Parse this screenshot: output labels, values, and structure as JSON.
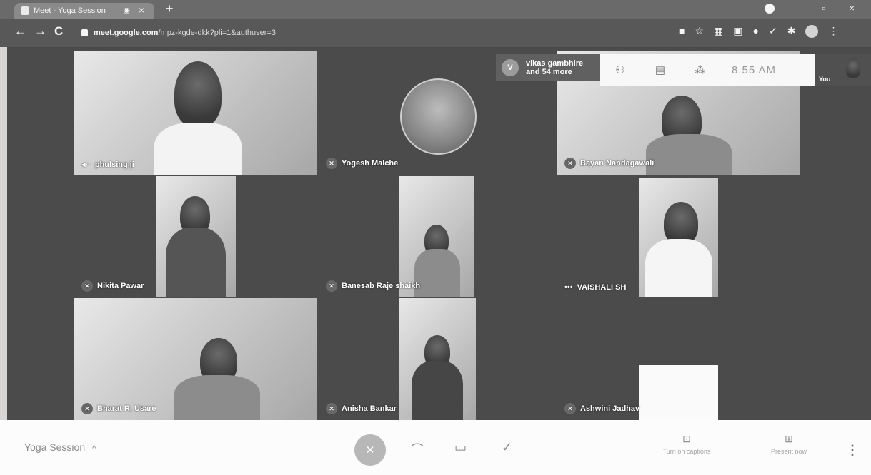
{
  "browser": {
    "tab_title": "Meet - Yoga Session",
    "tab_close": "×",
    "new_tab": "+",
    "url_host": "meet.google.com",
    "url_path": "/mpz-kgde-dkk?pli=1&authuser=3",
    "nav": {
      "back": "←",
      "forward": "→",
      "reload": "C"
    },
    "window_buttons": {
      "minimize": "–",
      "maximize": "▫",
      "close": "×"
    }
  },
  "meet": {
    "participants_chip": {
      "avatar_letter": "V",
      "line1": "vikas gambhire",
      "line2": "and 54 more"
    },
    "clock": "8:55 AM",
    "self_label": "You",
    "tiles": [
      {
        "name": "phulsing ji"
      },
      {
        "name": "Yogesh Malche"
      },
      {
        "name": "Bayan Nandagawali"
      },
      {
        "name": "Nikita Pawar"
      },
      {
        "name": "Banesab Raje shaikh"
      },
      {
        "name": "VAISHALI SH"
      },
      {
        "name": "Bharat R. Usare"
      },
      {
        "name": "Anisha Bankar"
      },
      {
        "name": "Ashwini Jadhav"
      }
    ]
  },
  "bottom_bar": {
    "meeting_title": "Yoga Session",
    "title_chevron": "^",
    "captions_label": "Turn on captions",
    "present_label": "Present now",
    "more": "⋮"
  },
  "colors": {
    "stage_bg": "#4f4d4b",
    "bottom_bar_bg": "#f7f6f5",
    "mic_button_bg": "#b8b4b0"
  }
}
